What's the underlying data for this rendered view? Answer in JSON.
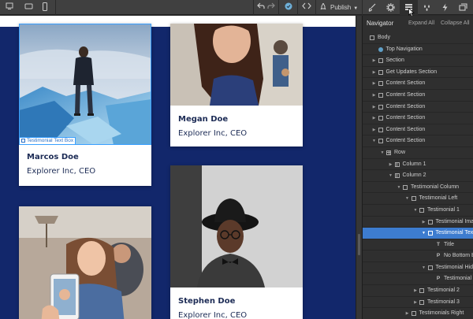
{
  "toolbar": {
    "left_icons": [
      "desktop-icon",
      "tablet-icon",
      "mobile-icon"
    ],
    "undo_icon": "undo-icon",
    "redo_icon": "redo-icon",
    "preview_icon": "preview-icon",
    "code_icon": "code-icon",
    "publish_label": "Publish",
    "right_icons": [
      "brush-icon",
      "gear-icon",
      "navigator-icon",
      "drops-icon",
      "lightning-icon",
      "assets-icon"
    ]
  },
  "canvas": {
    "background": "#12276b",
    "cards": [
      {
        "name": "Marcos Doe",
        "role": "Explorer Inc, CEO",
        "photo": "man-on-ice"
      },
      {
        "name": "Megan Doe",
        "role": "Explorer Inc, CEO",
        "photo": "woman-red-hair"
      },
      {
        "name": "",
        "role": "",
        "photo": "woman-selfie"
      },
      {
        "name": "Stephen Doe",
        "role": "Explorer Inc, CEO",
        "photo": "man-hat-glasses"
      }
    ],
    "selection_tag": "Testimonial Text Box"
  },
  "navigator": {
    "title": "Navigator",
    "expand_all": "Expand All",
    "collapse_all": "Collapse All",
    "accent": "#3d7ccf",
    "items": [
      {
        "label": "Body",
        "depth": 0,
        "arrow": "",
        "icon": "box"
      },
      {
        "label": "Top Navigation",
        "depth": 1,
        "arrow": "",
        "icon": "dot"
      },
      {
        "label": "Section",
        "depth": 1,
        "arrow": "right",
        "icon": "box"
      },
      {
        "label": "Get Updates Section",
        "depth": 1,
        "arrow": "right",
        "icon": "box"
      },
      {
        "label": "Content Section",
        "depth": 1,
        "arrow": "right",
        "icon": "box"
      },
      {
        "label": "Content Section",
        "depth": 1,
        "arrow": "right",
        "icon": "box"
      },
      {
        "label": "Content Section",
        "depth": 1,
        "arrow": "right",
        "icon": "box"
      },
      {
        "label": "Content Section",
        "depth": 1,
        "arrow": "right",
        "icon": "box"
      },
      {
        "label": "Content Section",
        "depth": 1,
        "arrow": "right",
        "icon": "box"
      },
      {
        "label": "Content Section",
        "depth": 1,
        "arrow": "down",
        "icon": "box"
      },
      {
        "label": "Row",
        "depth": 2,
        "arrow": "down",
        "icon": "grid"
      },
      {
        "label": "Column 1",
        "depth": 3,
        "arrow": "right",
        "icon": "col"
      },
      {
        "label": "Column 2",
        "depth": 3,
        "arrow": "down",
        "icon": "col"
      },
      {
        "label": "Testimonial Column",
        "depth": 4,
        "arrow": "down",
        "icon": "box"
      },
      {
        "label": "Testimonial Left",
        "depth": 5,
        "arrow": "down",
        "icon": "box"
      },
      {
        "label": "Testimonial 1",
        "depth": 6,
        "arrow": "down",
        "icon": "box"
      },
      {
        "label": "Testimonial Image",
        "depth": 7,
        "arrow": "right",
        "icon": "box"
      },
      {
        "label": "Testimonial Text Box",
        "depth": 7,
        "arrow": "down",
        "icon": "box",
        "selected": true
      },
      {
        "label": "Title",
        "depth": 8,
        "arrow": "",
        "icon": "T"
      },
      {
        "label": "No Bottom Bar",
        "depth": 8,
        "arrow": "",
        "icon": "P"
      },
      {
        "label": "Testimonial Hidden",
        "depth": 7,
        "arrow": "down",
        "icon": "box"
      },
      {
        "label": "Testimonial",
        "depth": 8,
        "arrow": "",
        "icon": "P"
      },
      {
        "label": "Testimonial 2",
        "depth": 6,
        "arrow": "right",
        "icon": "box"
      },
      {
        "label": "Testimonial 3",
        "depth": 6,
        "arrow": "right",
        "icon": "box"
      },
      {
        "label": "Testimonials Right",
        "depth": 5,
        "arrow": "right",
        "icon": "box"
      }
    ]
  }
}
